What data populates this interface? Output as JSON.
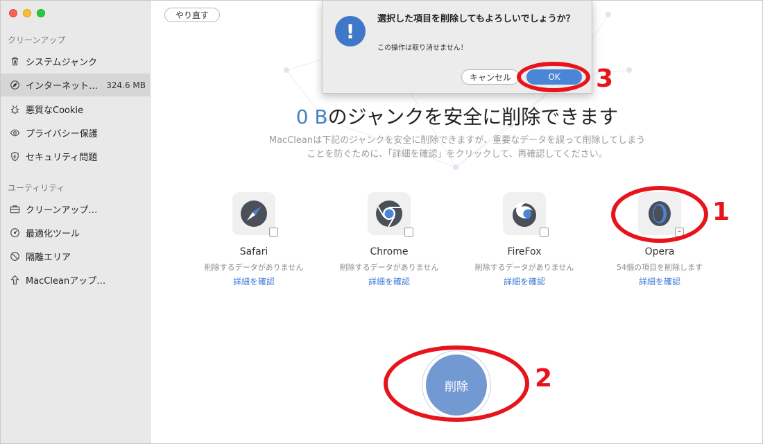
{
  "sidebar": {
    "section_cleanup": "クリーンアップ",
    "section_utility": "ユーティリティ",
    "items": [
      {
        "label": "システムジャンク",
        "icon": "trash-icon"
      },
      {
        "label": "インターネット…",
        "size": "324.6 MB",
        "icon": "compass-icon",
        "active": true
      },
      {
        "label": "悪質なCookie",
        "icon": "bug-icon"
      },
      {
        "label": "プライバシー保護",
        "icon": "eye-icon"
      },
      {
        "label": "セキュリティ問題",
        "icon": "shield-icon"
      },
      {
        "label": "クリーンアップ…",
        "icon": "briefcase-icon"
      },
      {
        "label": "最適化ツール",
        "icon": "gauge-icon"
      },
      {
        "label": "隔離エリア",
        "icon": "no-entry-icon"
      },
      {
        "label": "MacCleanアップ…",
        "icon": "upload-arrow-icon"
      }
    ]
  },
  "toolbar": {
    "redo_label": "やり直す"
  },
  "main": {
    "headline_amount": "0 B",
    "headline_text": "のジャンクを安全に削除できます",
    "desc_line1": "MacCleanは下記のジャンクを安全に削除できますが、重要なデータを誤って削除してしまう",
    "desc_line2": "ことを防ぐために、「詳細を確認」をクリックして、再確認してください。",
    "browsers": [
      {
        "name": "Safari",
        "status": "削除するデータがありません",
        "link": "詳細を確認",
        "checked": false
      },
      {
        "name": "Chrome",
        "status": "削除するデータがありません",
        "link": "詳細を確認",
        "checked": false
      },
      {
        "name": "FireFox",
        "status": "削除するデータがありません",
        "link": "詳細を確認",
        "checked": false
      },
      {
        "name": "Opera",
        "status": "54個の項目を削除します",
        "link": "詳細を確認",
        "checked": "partial",
        "check_glyph": "–"
      }
    ],
    "delete_label": "削除"
  },
  "dialog": {
    "icon_glyph": "!",
    "title": "選択した項目を削除してもよろしいでしょうか？",
    "message": "この操作は取り消せません！",
    "cancel_label": "キャンセル",
    "ok_label": "OK"
  },
  "annotations": {
    "n1": "1",
    "n2": "2",
    "n3": "3",
    "color": "#e8141c"
  },
  "colors": {
    "accent": "#4a7fc6",
    "delete_button": "#7399d2",
    "ok_button": "#4a86d6",
    "link": "#3b7ad6"
  }
}
